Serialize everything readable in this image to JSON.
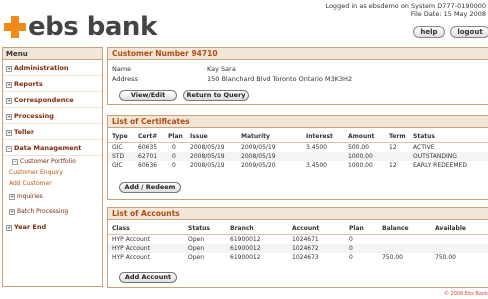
{
  "header": {
    "logo_text": "ebs bank",
    "login_line1": "Logged in as ebsdemo on System D777-0190000",
    "login_line2": "File Date: 15 May 2008",
    "help_label": "help",
    "logout_label": "logout"
  },
  "menu": {
    "title": "Menu",
    "items": [
      {
        "label": "Administration",
        "toggle": "+"
      },
      {
        "label": "Reports",
        "toggle": "+"
      },
      {
        "label": "Correspondence",
        "toggle": "+"
      },
      {
        "label": "Processing",
        "toggle": "+"
      },
      {
        "label": "Teller",
        "toggle": "+"
      },
      {
        "label": "Data Management",
        "toggle": "−"
      }
    ],
    "sub": {
      "customer_portfolio": "Customer Portfolio",
      "customer_enquiry": "Customer Enquiry",
      "add_customer": "Add Customer",
      "inquiries": "Inquiries",
      "batch_processing": "Batch Processing"
    },
    "year_end": "Year End"
  },
  "customer": {
    "title": "Customer Number 94710",
    "name_label": "Name",
    "name_value": "Kay Sara",
    "address_label": "Address",
    "address_value": "150 Blanchard Blvd Toronto Ontario M3K3H2",
    "view_edit_label": "View/Edit",
    "return_label": "Return to Query"
  },
  "certificates": {
    "title": "List of Certificates",
    "headers": [
      "Type",
      "Cert#",
      "Plan",
      "Issue",
      "Maturity",
      "Interest",
      "Amount",
      "Term",
      "Status"
    ],
    "rows": [
      [
        "GIC",
        "60635",
        "0",
        "2008/05/19",
        "2009/05/19",
        "3.4500",
        "500.00",
        "12",
        "ACTIVE"
      ],
      [
        "STD",
        "62701",
        "0",
        "2008/05/19",
        "2008/05/19",
        "",
        "1000.00",
        "",
        "OUTSTANDING"
      ],
      [
        "GIC",
        "60636",
        "0",
        "2008/05/19",
        "2009/05/20",
        "3.4500",
        "1000.00",
        "12",
        "EARLY REDEEMED"
      ]
    ],
    "add_label": "Add / Redeem"
  },
  "accounts": {
    "title": "List of Accounts",
    "headers": [
      "Class",
      "Status",
      "Branch",
      "Account",
      "Plan",
      "Balance",
      "Available"
    ],
    "rows": [
      [
        "HYP Account",
        "Open",
        "61900012",
        "1024671",
        "0",
        "",
        ""
      ],
      [
        "HYP Account",
        "Open",
        "61900012",
        "1024672",
        "0",
        "",
        ""
      ],
      [
        "HYP Account",
        "Open",
        "61900012",
        "1024673",
        "0",
        "750.00",
        "750.00"
      ]
    ],
    "add_label": "Add Account"
  },
  "footer": "© 2008 Ebs Bank"
}
